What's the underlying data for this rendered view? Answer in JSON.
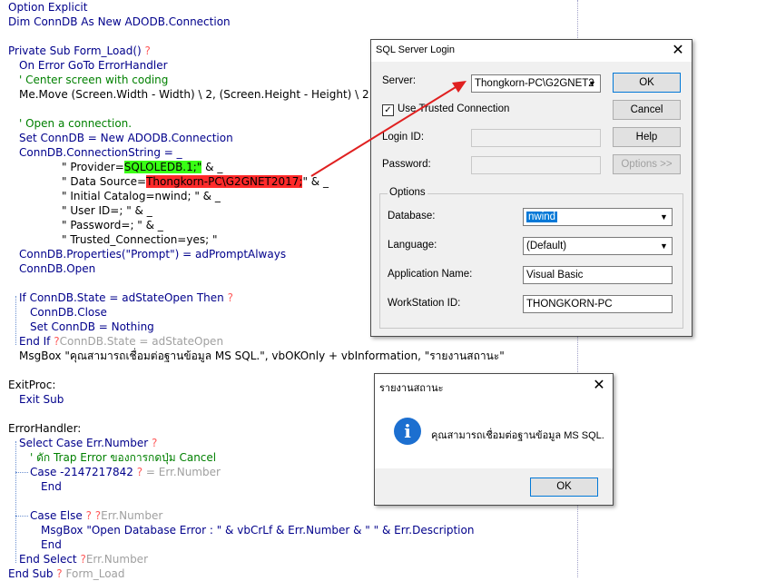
{
  "code": {
    "option_explicit": "Option Explicit",
    "dim_line": "Dim ConnDB As New ADODB.Connection",
    "sub_decl_kw": "Private Sub Form_Load()",
    "qmark": "?",
    "on_error": "On Error GoTo ErrorHandler",
    "comment_center": "' Center screen with coding",
    "me_move": "Me.Move (Screen.Width - Width) \\ 2, (Screen.Height - Height) \\ 2",
    "comment_open": "' Open a connection.",
    "set_conndb": "Set ConnDB = New ADODB.Connection",
    "conn_string": "ConnDB.ConnectionString = _",
    "provider_pre": "\" Provider=",
    "provider_val": "SQLOLEDB.1;\"",
    "provider_post": " & _",
    "datasource_pre": "\" Data Source=",
    "datasource_val": "Thongkorn-PC\\G2GNET2017;",
    "datasource_post": "\" & _",
    "initial_catalog": "\" Initial Catalog=nwind; \" & _",
    "user_id": "\" User ID=; \" & _",
    "password": "\" Password=; \" & _",
    "trusted": "\" Trusted_Connection=yes; \"",
    "properties": "ConnDB.Properties(\"Prompt\") = adPromptAlways",
    "conn_open": "ConnDB.Open",
    "if_line": "If ConnDB.State = adStateOpen Then",
    "conn_close": "ConnDB.Close",
    "set_nothing": "Set ConnDB = Nothing",
    "end_if": "End If",
    "end_if_hint": "ConnDB.State = adStateOpen",
    "msgbox_line": "MsgBox \"คุณสามารถเชื่อมต่อฐานข้อมูล MS SQL.\", vbOKOnly + vbInformation, \"รายงานสถานะ\"",
    "exitproc": "ExitProc:",
    "exit_sub": "Exit Sub",
    "errorhandler": "ErrorHandler:",
    "select_case": "Select Case Err.Number",
    "comment_trap": "' ดัก Trap Error ของการกดปุ่ม Cancel",
    "case_num": "Case -2147217842",
    "case_num_hint": "= Err.Number",
    "end_1": "End",
    "case_else": "Case Else",
    "case_else_hint": "Err.Number",
    "msgbox_err": "MsgBox \"Open Database Error : \" & vbCrLf & Err.Number & \" \" & Err.Description",
    "end_2": "End",
    "end_select": "End Select",
    "end_select_hint": "Err.Number",
    "end_sub": "End Sub",
    "end_sub_hint": "Form_Load"
  },
  "sql_login": {
    "title": "SQL Server Login",
    "server_label": "Server:",
    "server_value": "Thongkorn-PC\\G2GNET2",
    "use_trusted_label": "Use Trusted Connection",
    "use_trusted_checked": true,
    "login_id_label": "Login ID:",
    "password_label": "Password:",
    "ok_label": "OK",
    "cancel_label": "Cancel",
    "help_label": "Help",
    "options_label": "Options >>",
    "options_group": "Options",
    "database_label": "Database:",
    "database_value": "nwind",
    "language_label": "Language:",
    "language_value": "(Default)",
    "app_name_label": "Application Name:",
    "app_name_value": "Visual Basic",
    "workstation_label": "WorkStation ID:",
    "workstation_value": "THONGKORN-PC"
  },
  "msgbox": {
    "title": "รายงานสถานะ",
    "message": "คุณสามารถเชื่อมต่อฐานข้อมูล MS SQL.",
    "ok_label": "OK",
    "icon": "information-icon"
  },
  "colors": {
    "keyword": "#00008b",
    "comment": "#008000",
    "highlight_green": "#39ff14",
    "highlight_red": "#ff2a2a",
    "arrow": "#e02020"
  }
}
